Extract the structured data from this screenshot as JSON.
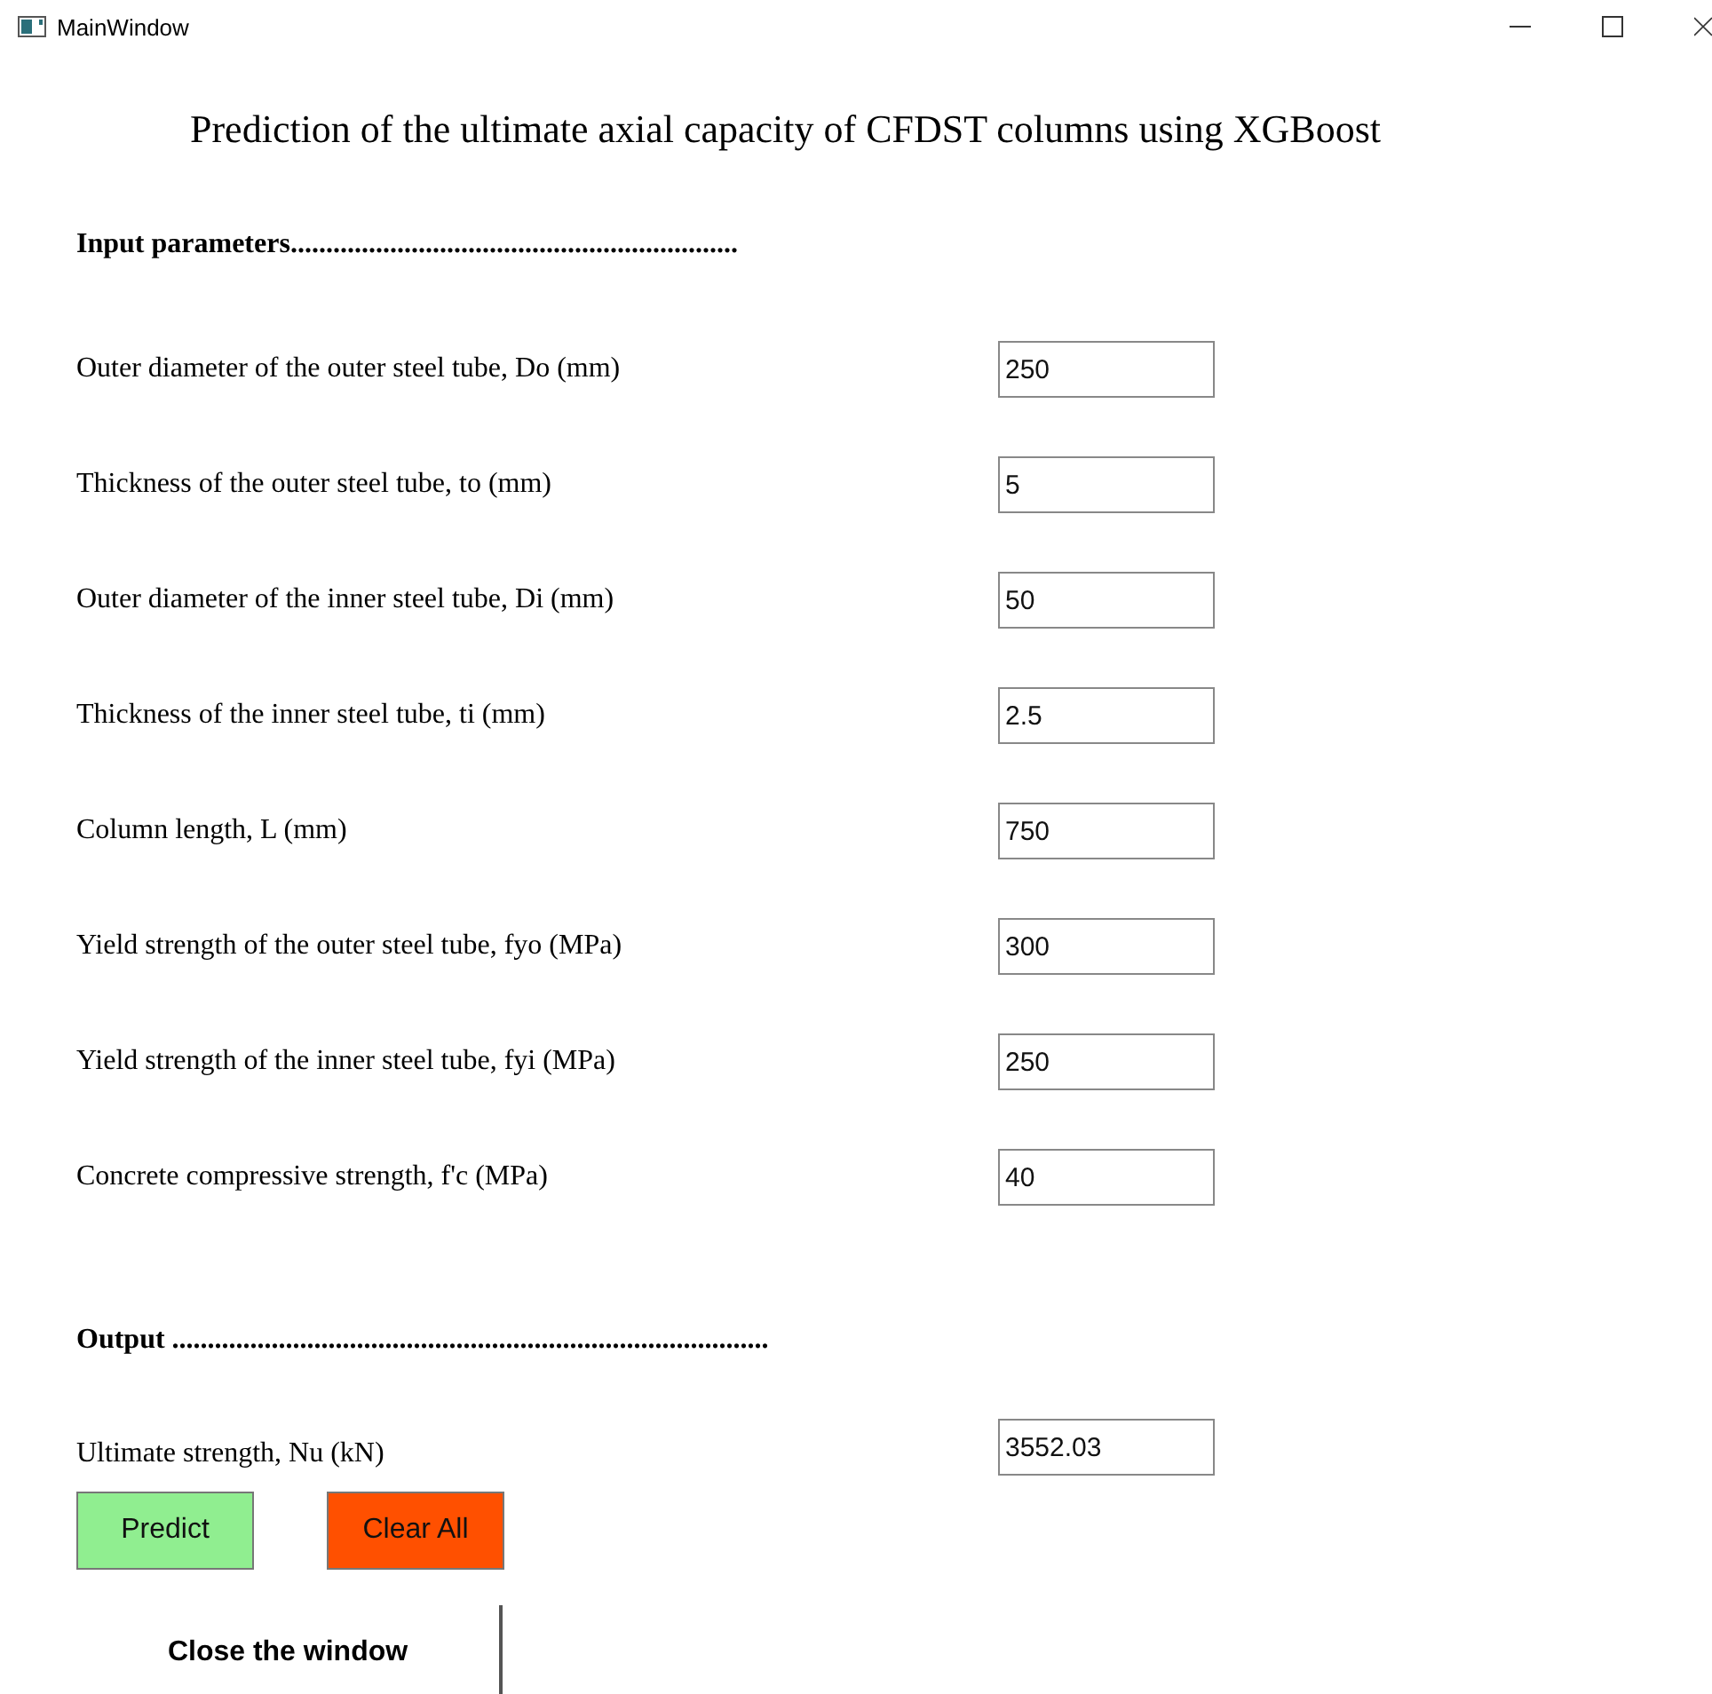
{
  "window": {
    "title": "MainWindow"
  },
  "heading": "Prediction of the ultimate axial capacity of CFDST columns using XGBoost",
  "input_section": {
    "title": "Input parameters...............................................................",
    "fields": [
      {
        "label": "Outer diameter of the outer steel tube, Do (mm)",
        "value": "250"
      },
      {
        "label": "Thickness of the outer steel tube, to (mm)",
        "value": "5"
      },
      {
        "label": "Outer diameter of the inner steel tube, Di (mm)",
        "value": "50"
      },
      {
        "label": "Thickness of the inner steel tube, ti (mm)",
        "value": "2.5"
      },
      {
        "label": "Column length, L (mm)",
        "value": "750"
      },
      {
        "label": "Yield strength of the outer steel tube, fyo (MPa)",
        "value": "300"
      },
      {
        "label": "Yield strength of the inner steel tube, fyi (MPa)",
        "value": "250"
      },
      {
        "label": "Concrete compressive strength, f'c (MPa)",
        "value": "40"
      }
    ]
  },
  "output_section": {
    "title": "Output ....................................................................................",
    "field": {
      "label": "Ultimate strength, Nu (kN)",
      "value": "3552.03"
    }
  },
  "buttons": [
    {
      "label": "Predict",
      "kind": "predict"
    },
    {
      "label": "Clear All",
      "kind": "clear"
    }
  ],
  "close_button": {
    "label": "Close the window"
  }
}
